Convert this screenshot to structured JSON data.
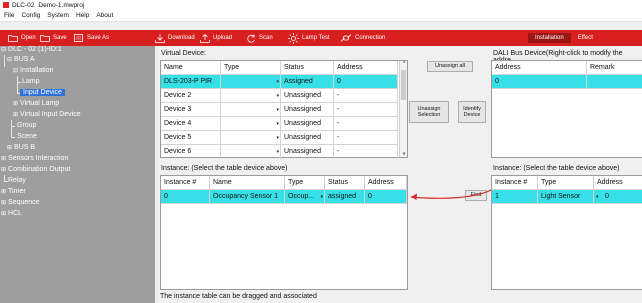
{
  "window": {
    "app_name": "DLC-02",
    "project": "Demo-1.mwproj"
  },
  "menu": [
    "File",
    "Config",
    "System",
    "Help",
    "About"
  ],
  "toolbar": {
    "open": "Open",
    "save": "Save",
    "save_as": "Save As",
    "download": "Download",
    "upload": "Upload",
    "scan": "Scan",
    "lamp_test": "Lamp Test",
    "connection": "Connection",
    "mode_installation": "Installation",
    "mode_effect": "Effect",
    "accent_color": "#d81f1f"
  },
  "tree": {
    "root": "DLC - 02 (1)-ID:1",
    "bus_a": "BUS A",
    "installation": "Installation",
    "lamp": "Lamp",
    "input_device": "Input Device",
    "virtual_lamp": "Virtual Lamp",
    "virtual_input_device": "Virtual Input Device",
    "group": "Group",
    "scene": "Scene",
    "bus_b": "BUS B",
    "sensors_interaction": "Sensors Interaction",
    "combination_output": "Combination Output",
    "relay": "Relay",
    "timer": "Timer",
    "sequence": "Sequence",
    "hcl": "HCL"
  },
  "virtual_device": {
    "title": "Virtual Device:",
    "columns": [
      "Name",
      "Type",
      "Status",
      "Address"
    ],
    "rows": [
      {
        "name": "DLS-203-P PIR",
        "type": "",
        "status": "Assigned",
        "address": "0"
      },
      {
        "name": "Device 2",
        "type": "",
        "status": "Unassigned",
        "address": "-"
      },
      {
        "name": "Device 3",
        "type": "",
        "status": "Unassigned",
        "address": "-"
      },
      {
        "name": "Device 4",
        "type": "",
        "status": "Unassigned",
        "address": "-"
      },
      {
        "name": "Device 5",
        "type": "",
        "status": "Unassigned",
        "address": "-"
      },
      {
        "name": "Device 6",
        "type": "",
        "status": "Unassigned",
        "address": "-"
      }
    ]
  },
  "buttons": {
    "unassign_all": "Unassign all",
    "unassign_selection_1": "Unassign",
    "unassign_selection_2": "Selection",
    "identify_device_1": "Identify",
    "identify_device_2": "Device",
    "find": "Find"
  },
  "dali_bus": {
    "title": "DALI Bus Device(Right-click to modify the addre",
    "columns": [
      "Address",
      "Remark"
    ],
    "rows": [
      {
        "address": "0",
        "remark": ""
      }
    ]
  },
  "instance_left": {
    "title": "Instance:  (Select the table device above)",
    "columns": [
      "Instance #",
      "Name",
      "Type",
      "Status",
      "Address"
    ],
    "rows": [
      {
        "instance": "0",
        "name": "Occupancy Sensor 1",
        "type": "Occup...",
        "status": "assigned",
        "address": "0"
      }
    ]
  },
  "instance_right": {
    "title": "Instance:   (Select the table device above)",
    "columns": [
      "Instance #",
      "Type",
      "Address"
    ],
    "rows": [
      {
        "instance": "1",
        "type": "Light Sensor",
        "address": "0"
      }
    ]
  },
  "footer_note": "The instance table can be dragged and associated",
  "colors": {
    "row_highlight": "#37e0e6",
    "arrow": "#d42b2b",
    "tree_bg": "#9e9e9e",
    "tree_selected": "#2f72d8"
  }
}
